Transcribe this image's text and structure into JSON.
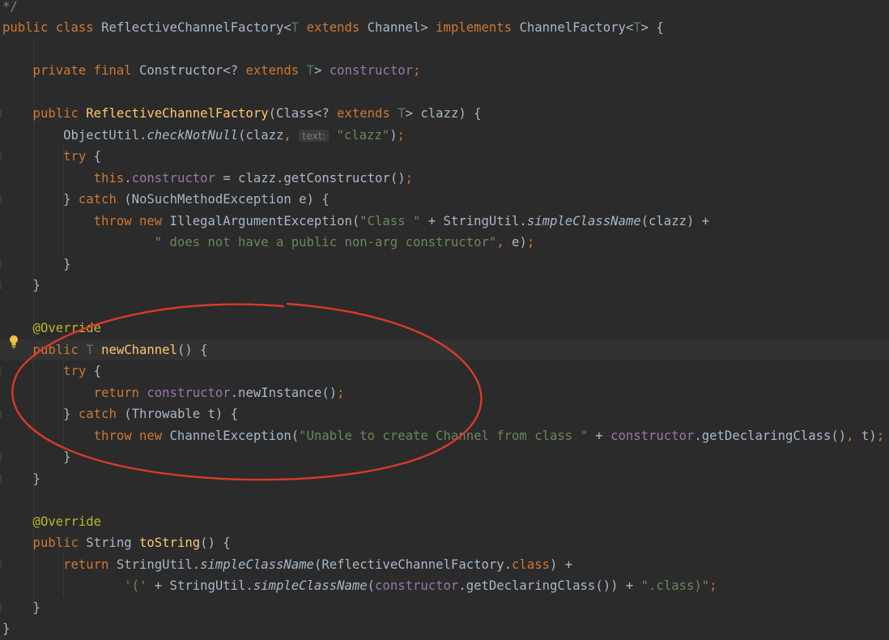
{
  "editor": {
    "lines": [
      [
        {
          "t": "*/",
          "c": "cmt"
        }
      ],
      [
        {
          "t": "public class ",
          "c": "kw"
        },
        {
          "t": "ReflectiveChannelFactory<",
          "c": "ty"
        },
        {
          "t": "T",
          "c": "tp"
        },
        {
          "t": " ",
          "c": "ty"
        },
        {
          "t": "extends",
          "c": "kw"
        },
        {
          "t": " Channel> ",
          "c": "ty"
        },
        {
          "t": "implements",
          "c": "kw"
        },
        {
          "t": " ChannelFactory<",
          "c": "ty"
        },
        {
          "t": "T",
          "c": "tp"
        },
        {
          "t": "> {",
          "c": "ty"
        }
      ],
      [],
      [
        {
          "t": "    private final ",
          "c": "kw"
        },
        {
          "t": "Constructor<? ",
          "c": "ty"
        },
        {
          "t": "extends",
          "c": "kw"
        },
        {
          "t": " ",
          "c": "ty"
        },
        {
          "t": "T",
          "c": "tp"
        },
        {
          "t": "> ",
          "c": "ty"
        },
        {
          "t": "constructor",
          "c": "fld"
        },
        {
          "t": ";",
          "c": "kw"
        }
      ],
      [],
      [
        {
          "t": "    public ",
          "c": "kw"
        },
        {
          "t": "ReflectiveChannelFactory",
          "c": "fn"
        },
        {
          "t": "(Class<? ",
          "c": "ty"
        },
        {
          "t": "extends",
          "c": "kw"
        },
        {
          "t": " ",
          "c": "ty"
        },
        {
          "t": "T",
          "c": "tp"
        },
        {
          "t": "> clazz) {",
          "c": "ty"
        }
      ],
      [
        {
          "t": "        ObjectUtil.",
          "c": "ty"
        },
        {
          "t": "checkNotNull",
          "c": "ty it"
        },
        {
          "t": "(clazz",
          "c": "ty"
        },
        {
          "t": ", ",
          "c": "kw"
        },
        {
          "t": "text:",
          "c": "hint"
        },
        {
          "t": " ",
          "c": "ty"
        },
        {
          "t": "\"clazz\"",
          "c": "str"
        },
        {
          "t": ")",
          "c": "ty"
        },
        {
          "t": ";",
          "c": "kw"
        }
      ],
      [
        {
          "t": "        try ",
          "c": "kw"
        },
        {
          "t": "{",
          "c": "ty"
        }
      ],
      [
        {
          "t": "            this",
          "c": "kw"
        },
        {
          "t": ".",
          "c": "ty"
        },
        {
          "t": "constructor",
          "c": "fld"
        },
        {
          "t": " = clazz.getConstructor()",
          "c": "ty"
        },
        {
          "t": ";",
          "c": "kw"
        }
      ],
      [
        {
          "t": "        } ",
          "c": "ty"
        },
        {
          "t": "catch ",
          "c": "kw"
        },
        {
          "t": "(NoSuchMethodException e) {",
          "c": "ty"
        }
      ],
      [
        {
          "t": "            throw new ",
          "c": "kw"
        },
        {
          "t": "IllegalArgumentException(",
          "c": "ty"
        },
        {
          "t": "\"Class \"",
          "c": "str"
        },
        {
          "t": " + StringUtil.",
          "c": "ty"
        },
        {
          "t": "simpleClassName",
          "c": "ty it"
        },
        {
          "t": "(clazz) +",
          "c": "ty"
        }
      ],
      [
        {
          "t": "                    ",
          "c": "ty"
        },
        {
          "t": "\" does not have a public non-arg constructor\"",
          "c": "str"
        },
        {
          "t": ", ",
          "c": "kw"
        },
        {
          "t": "e)",
          "c": "ty"
        },
        {
          "t": ";",
          "c": "kw"
        }
      ],
      [
        {
          "t": "        }",
          "c": "ty"
        }
      ],
      [
        {
          "t": "    }",
          "c": "ty"
        }
      ],
      [],
      [
        {
          "t": "    @Override",
          "c": "ann"
        }
      ],
      [
        {
          "t": "    public ",
          "c": "kw"
        },
        {
          "t": "T",
          "c": "tp"
        },
        {
          "t": " ",
          "c": "ty"
        },
        {
          "t": "newChannel",
          "c": "fn"
        },
        {
          "t": "() {",
          "c": "ty"
        }
      ],
      [
        {
          "t": "        try ",
          "c": "kw"
        },
        {
          "t": "{",
          "c": "ty"
        }
      ],
      [
        {
          "t": "            return ",
          "c": "kw"
        },
        {
          "t": "constructor",
          "c": "fld"
        },
        {
          "t": ".newInstance()",
          "c": "ty"
        },
        {
          "t": ";",
          "c": "kw"
        }
      ],
      [
        {
          "t": "        } ",
          "c": "ty"
        },
        {
          "t": "catch ",
          "c": "kw"
        },
        {
          "t": "(Throwable t) {",
          "c": "ty"
        }
      ],
      [
        {
          "t": "            throw new ",
          "c": "kw"
        },
        {
          "t": "ChannelException(",
          "c": "ty"
        },
        {
          "t": "\"Unable to create Channel from class \"",
          "c": "str"
        },
        {
          "t": " + ",
          "c": "ty"
        },
        {
          "t": "constructor",
          "c": "fld"
        },
        {
          "t": ".getDeclaringClass()",
          "c": "ty"
        },
        {
          "t": ", ",
          "c": "kw"
        },
        {
          "t": "t)",
          "c": "ty"
        },
        {
          "t": ";",
          "c": "kw"
        }
      ],
      [
        {
          "t": "        }",
          "c": "ty"
        }
      ],
      [
        {
          "t": "    }",
          "c": "ty"
        }
      ],
      [],
      [
        {
          "t": "    @Override",
          "c": "ann"
        }
      ],
      [
        {
          "t": "    public ",
          "c": "kw"
        },
        {
          "t": "String ",
          "c": "ty"
        },
        {
          "t": "toString",
          "c": "fn"
        },
        {
          "t": "() {",
          "c": "ty"
        }
      ],
      [
        {
          "t": "        return ",
          "c": "kw"
        },
        {
          "t": "StringUtil.",
          "c": "ty"
        },
        {
          "t": "simpleClassName",
          "c": "ty it"
        },
        {
          "t": "(ReflectiveChannelFactory.",
          "c": "ty"
        },
        {
          "t": "class",
          "c": "kw"
        },
        {
          "t": ") +",
          "c": "ty"
        }
      ],
      [
        {
          "t": "                ",
          "c": "ty"
        },
        {
          "t": "'('",
          "c": "str"
        },
        {
          "t": " + StringUtil.",
          "c": "ty"
        },
        {
          "t": "simpleClassName",
          "c": "ty it"
        },
        {
          "t": "(",
          "c": "ty"
        },
        {
          "t": "constructor",
          "c": "fld"
        },
        {
          "t": ".getDeclaringClass()) + ",
          "c": "ty"
        },
        {
          "t": "\".class)\"",
          "c": "str"
        },
        {
          "t": ";",
          "c": "kw"
        }
      ],
      [
        {
          "t": "    }",
          "c": "ty"
        }
      ],
      [
        {
          "t": "}",
          "c": "ty"
        }
      ]
    ],
    "current_line": 16,
    "intention_line": 16,
    "intention_icon": "lightbulb-icon"
  },
  "annotation": {
    "shape": "hand-drawn-ellipse",
    "color": "#d83a2a"
  },
  "colors": {
    "background": "#2b2b2b",
    "keyword": "#cc7832",
    "string": "#6a8759",
    "field": "#9876aa",
    "method": "#ffc66d",
    "annotation": "#bbb529",
    "type_param": "#507874"
  }
}
